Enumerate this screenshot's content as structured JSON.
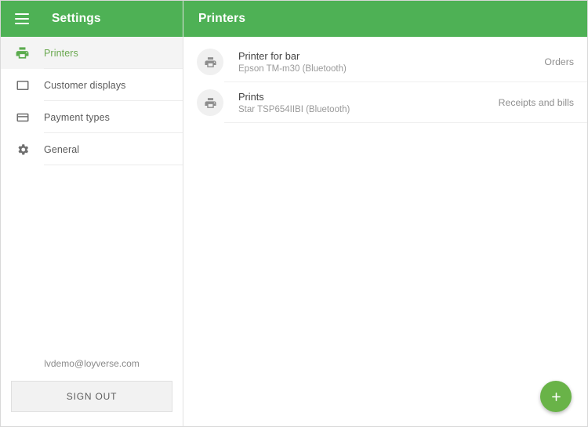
{
  "sidebar": {
    "menu_icon": "hamburger-icon",
    "title": "Settings",
    "items": [
      {
        "label": "Printers",
        "icon": "printer-icon",
        "selected": true
      },
      {
        "label": "Customer displays",
        "icon": "display-icon",
        "selected": false
      },
      {
        "label": "Payment types",
        "icon": "credit-card-icon",
        "selected": false
      },
      {
        "label": "General",
        "icon": "gear-icon",
        "selected": false
      }
    ],
    "account_email": "lvdemo@loyverse.com",
    "sign_out_label": "SIGN OUT"
  },
  "content": {
    "title": "Printers",
    "add_button_icon": "plus-icon",
    "printers": [
      {
        "name": "Printer for bar",
        "model": "Epson TM-m30 (Bluetooth)",
        "role": "Orders",
        "icon": "printer-icon"
      },
      {
        "name": "Prints",
        "model": "Star TSP654IIBI (Bluetooth)",
        "role": "Receipts and bills",
        "icon": "printer-icon"
      }
    ]
  },
  "colors": {
    "header_green": "#4eb155",
    "accent_green": "#6aa84f",
    "fab_green": "#69b348",
    "selected_row_bg": "#f4f4f4",
    "divider": "#ececec"
  }
}
